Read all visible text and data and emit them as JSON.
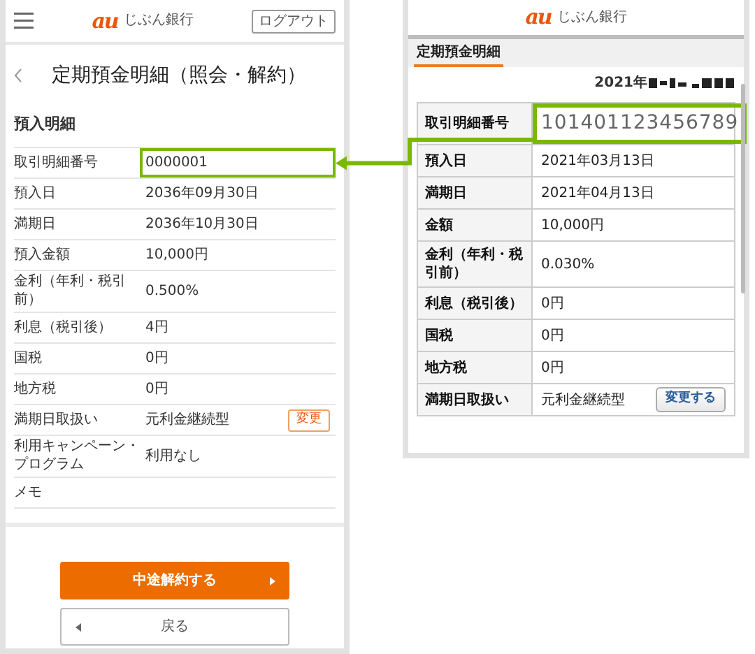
{
  "left_screen": {
    "logo_mark": "au",
    "logo_text": "じぶん銀行",
    "logout_button": "ログアウト",
    "title": "定期預金明細（照会・解約）",
    "section_title": "預入明細",
    "rows": [
      {
        "label": "取引明細番号",
        "value": "0000001",
        "highlighted": true
      },
      {
        "label": "預入日",
        "value": "2036年09月30日",
        "highlighted": false
      },
      {
        "label": "満期日",
        "value": "2036年10月30日",
        "highlighted": false
      },
      {
        "label": "預入金額",
        "value": "10,000円",
        "highlighted": false
      },
      {
        "label": "金利（年利・税引前）",
        "value": "0.500%",
        "highlighted": false
      },
      {
        "label": "利息（税引後）",
        "value": "4円",
        "highlighted": false
      },
      {
        "label": "国税",
        "value": "0円",
        "highlighted": false
      },
      {
        "label": "地方税",
        "value": "0円",
        "highlighted": false
      },
      {
        "label": "満期日取扱い",
        "value": "元利金継続型",
        "highlighted": false,
        "action": "変更"
      },
      {
        "label": "利用キャンペーン・プログラム",
        "value": "利用なし",
        "highlighted": false
      },
      {
        "label": "メモ",
        "highlighted": false
      }
    ],
    "buttons": [
      {
        "label": "中途解約する",
        "kind": "primary"
      },
      {
        "label": "戻る",
        "kind": "secondary"
      }
    ]
  },
  "right_screen": {
    "logo_mark": "au",
    "logo_text": "じぶん銀行",
    "tab": {
      "label": "定期預金明細",
      "selected": true
    },
    "date": "2021年",
    "rows": [
      {
        "label": "取引明細番号",
        "value": "101401123456789",
        "highlighted": true
      },
      {
        "label": "預入日",
        "value": "2021年03月13日",
        "highlighted": false
      },
      {
        "label": "満期日",
        "value": "2021年04月13日",
        "highlighted": false
      },
      {
        "label": "金額",
        "value": "10,000円",
        "highlighted": false
      },
      {
        "label": "金利（年利・税引前）",
        "value": "0.030%",
        "highlighted": false
      },
      {
        "label": "利息（税引後）",
        "value": "0円",
        "highlighted": false
      },
      {
        "label": "国税",
        "value": "0円",
        "highlighted": false
      },
      {
        "label": "地方税",
        "value": "0円",
        "highlighted": false
      },
      {
        "label": "満期日取扱い",
        "value": "元利金継続型",
        "highlighted": false,
        "action": "変更する"
      }
    ]
  }
}
